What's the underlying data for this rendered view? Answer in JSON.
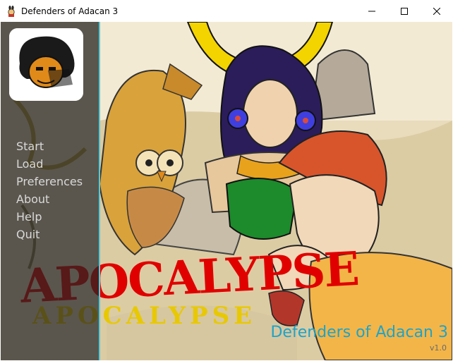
{
  "window": {
    "title": "Defenders of Adacan 3",
    "app_icon": "bunny-avatar-icon",
    "controls": {
      "minimize": "minimize-icon",
      "maximize": "maximize-icon",
      "close": "close-icon"
    }
  },
  "menu": {
    "items": [
      {
        "label": "Start"
      },
      {
        "label": "Load"
      },
      {
        "label": "Preferences"
      },
      {
        "label": "About"
      },
      {
        "label": "Help"
      },
      {
        "label": "Quit"
      }
    ]
  },
  "game": {
    "title": "Defenders of Adacan 3",
    "version": "v1.0",
    "banner_text": "Apocalypse"
  },
  "colors": {
    "menu_text": "#d9d9d9",
    "title_text": "#1ea3c8",
    "panel_edge": "#58c9d8",
    "banner_red": "#e00000",
    "banner_yellow": "#e8c800"
  }
}
